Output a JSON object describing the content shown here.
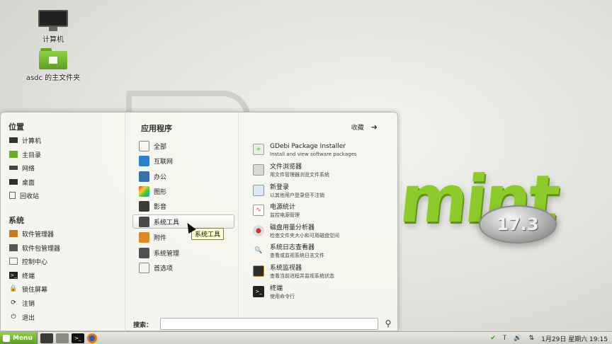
{
  "desktop": {
    "icons": [
      {
        "label": "计算机"
      },
      {
        "label": "asdc 的主文件夹"
      }
    ],
    "background": {
      "word": "mint",
      "version": "17.3"
    }
  },
  "menu": {
    "places": {
      "title": "位置",
      "items": [
        {
          "label": "计算机",
          "icon": "computer-icon"
        },
        {
          "label": "主目录",
          "icon": "home-folder-icon"
        },
        {
          "label": "网络",
          "icon": "network-icon"
        },
        {
          "label": "桌面",
          "icon": "desktop-icon"
        },
        {
          "label": "回收站",
          "icon": "trash-icon"
        }
      ]
    },
    "system": {
      "title": "系统",
      "items": [
        {
          "label": "软件管理器",
          "icon": "software-manager-icon"
        },
        {
          "label": "软件包管理器",
          "icon": "package-manager-icon"
        },
        {
          "label": "控制中心",
          "icon": "control-center-icon"
        },
        {
          "label": "终端",
          "icon": "terminal-icon"
        },
        {
          "label": "锁住屏幕",
          "icon": "lock-icon"
        },
        {
          "label": "注销",
          "icon": "logout-icon"
        },
        {
          "label": "退出",
          "icon": "power-icon"
        }
      ]
    },
    "applications": {
      "title": "应用程序",
      "favorites_label": "收藏",
      "categories": [
        {
          "label": "全部"
        },
        {
          "label": "互联网"
        },
        {
          "label": "办公"
        },
        {
          "label": "图形"
        },
        {
          "label": "影音"
        },
        {
          "label": "系统工具"
        },
        {
          "label": "附件"
        },
        {
          "label": "系统管理"
        },
        {
          "label": "首选项"
        }
      ],
      "selected_category": "系统工具",
      "apps": [
        {
          "name": "GDebi Package Installer",
          "desc": "Install and view software packages"
        },
        {
          "name": "文件浏览器",
          "desc": "用文件管理器浏览文件系统"
        },
        {
          "name": "新登录",
          "desc": "以其他用户登录但不注销"
        },
        {
          "name": "电源统计",
          "desc": "监控电源管理"
        },
        {
          "name": "磁盘用量分析器",
          "desc": "检查文件夹大小和可用磁盘空间"
        },
        {
          "name": "系统日志查看器",
          "desc": "查看或监视系统日志文件"
        },
        {
          "name": "系统监视器",
          "desc": "查看当前进程并监视系统状态"
        },
        {
          "name": "终端",
          "desc": "使用命令行"
        }
      ]
    },
    "search": {
      "label": "搜索：",
      "value": ""
    },
    "tooltip": "系统工具"
  },
  "panel": {
    "menu_label": "Menu",
    "clock": "1月29日 星期六 19:15"
  },
  "colors": {
    "accent": "#87c540",
    "panel": "#dcdcd5",
    "menu_bg": "#f6f6f0"
  }
}
